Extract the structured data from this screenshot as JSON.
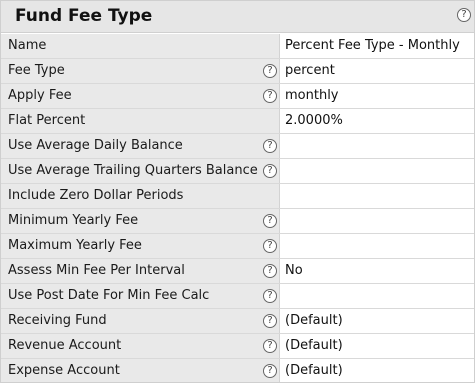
{
  "panel": {
    "title": "Fund Fee Type",
    "help_icon": "help-icon"
  },
  "fields": [
    {
      "label": "Name",
      "value": "Percent Fee Type - Monthly",
      "help": false
    },
    {
      "label": "Fee Type",
      "value": "percent",
      "help": true
    },
    {
      "label": "Apply Fee",
      "value": "monthly",
      "help": true
    },
    {
      "label": "Flat Percent",
      "value": "2.0000%",
      "help": false
    },
    {
      "label": "Use Average Daily Balance",
      "value": "",
      "help": true
    },
    {
      "label": "Use Average Trailing Quarters Balance",
      "value": "",
      "help": true
    },
    {
      "label": "Include Zero Dollar Periods",
      "value": "",
      "help": false
    },
    {
      "label": "Minimum Yearly Fee",
      "value": "",
      "help": true
    },
    {
      "label": "Maximum Yearly Fee",
      "value": "",
      "help": true
    },
    {
      "label": "Assess Min Fee Per Interval",
      "value": "No",
      "help": true
    },
    {
      "label": "Use Post Date For Min Fee Calc",
      "value": "",
      "help": true
    },
    {
      "label": "Receiving Fund",
      "value": "(Default)",
      "help": true
    },
    {
      "label": "Revenue Account",
      "value": "(Default)",
      "help": true
    },
    {
      "label": "Expense Account",
      "value": "(Default)",
      "help": true
    }
  ],
  "help_glyph": "?"
}
